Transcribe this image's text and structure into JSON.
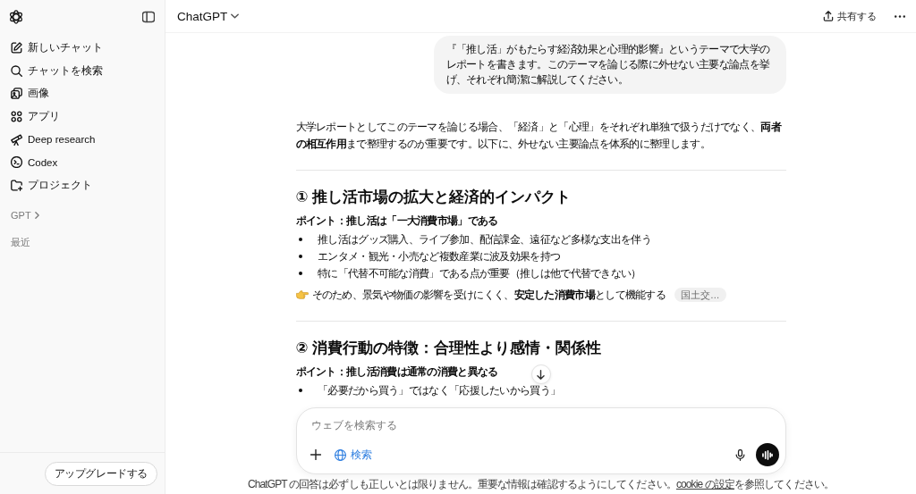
{
  "sidebar": {
    "nav_items": [
      {
        "label": "新しいチャット"
      },
      {
        "label": "チャットを検索"
      },
      {
        "label": "画像"
      },
      {
        "label": "アプリ"
      },
      {
        "label": "Deep research"
      },
      {
        "label": "Codex"
      },
      {
        "label": "プロジェクト"
      }
    ],
    "gpt_section": {
      "label": "GPT",
      "expanded": false
    },
    "recent_heading": "最近",
    "upgrade_button": "アップグレードする"
  },
  "header": {
    "model": "ChatGPT",
    "share_button": "共有する"
  },
  "thread": {
    "user_message": "『「推し活」がもたらす経済効果と心理的影響』というテーマで大学のレポートを書きます。このテーマを論じる際に外せない主要な論点を挙げ、それぞれ簡潔に解説してください。",
    "assistant_intro": "大学レポートとしてこのテーマを論じる場合、「経済」と「心理」をそれぞれ単独で扱うだけでなく、**両者の相互作用**まで整理するのが重要です。以下に、外せない主要論点を体系的に整理します。",
    "sections": [
      {
        "heading": "① 推し活市場の拡大と経済的インパクト",
        "point": "ポイント：推し活は「一大消費市場」である",
        "bullets": [
          "推し活はグッズ購入、ライブ参加、配信課金、遠征など多様な支出を伴う",
          "エンタメ・観光・小売など複数産業に波及効果を持つ",
          "特に「代替不可能な消費」である点が重要（推しは他で代替できない）"
        ],
        "conclusion": "そのため、景気や物価の影響を受けにくく、**安定した消費市場**として機能する",
        "citation": "国土交…"
      },
      {
        "heading": "② 消費行動の特徴：合理性より感情・関係性",
        "point": "ポイント：推し活消費は通常の消費と異なる",
        "bullets": [
          "「必要だから買う」ではなく「応援したいから買う」"
        ]
      }
    ]
  },
  "composer": {
    "placeholder": "ウェブを検索する",
    "search_tool": {
      "label": "検索",
      "selected": true
    }
  },
  "disclaimer": {
    "before": "ChatGPT の回答は必ずしも正しいとは限りません。重要な情報は確認するようにしてください。",
    "link": "cookie の設定",
    "after": "を参照してください。"
  }
}
